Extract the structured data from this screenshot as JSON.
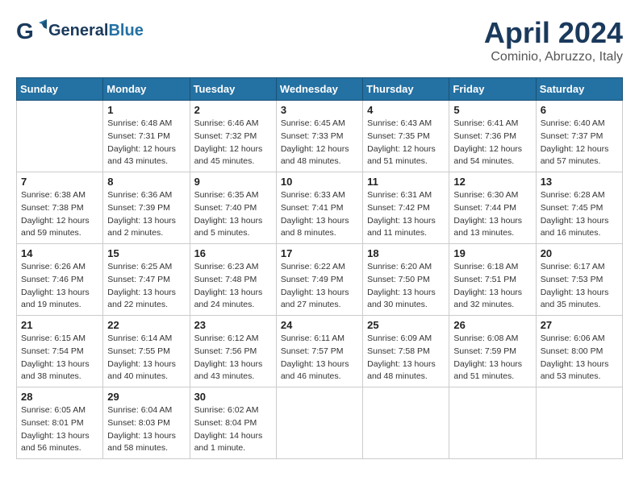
{
  "header": {
    "logo_general": "General",
    "logo_blue": "Blue",
    "month": "April 2024",
    "location": "Cominio, Abruzzo, Italy"
  },
  "weekdays": [
    "Sunday",
    "Monday",
    "Tuesday",
    "Wednesday",
    "Thursday",
    "Friday",
    "Saturday"
  ],
  "weeks": [
    [
      {
        "day": "",
        "sunrise": "",
        "sunset": "",
        "daylight": ""
      },
      {
        "day": "1",
        "sunrise": "Sunrise: 6:48 AM",
        "sunset": "Sunset: 7:31 PM",
        "daylight": "Daylight: 12 hours and 43 minutes."
      },
      {
        "day": "2",
        "sunrise": "Sunrise: 6:46 AM",
        "sunset": "Sunset: 7:32 PM",
        "daylight": "Daylight: 12 hours and 45 minutes."
      },
      {
        "day": "3",
        "sunrise": "Sunrise: 6:45 AM",
        "sunset": "Sunset: 7:33 PM",
        "daylight": "Daylight: 12 hours and 48 minutes."
      },
      {
        "day": "4",
        "sunrise": "Sunrise: 6:43 AM",
        "sunset": "Sunset: 7:35 PM",
        "daylight": "Daylight: 12 hours and 51 minutes."
      },
      {
        "day": "5",
        "sunrise": "Sunrise: 6:41 AM",
        "sunset": "Sunset: 7:36 PM",
        "daylight": "Daylight: 12 hours and 54 minutes."
      },
      {
        "day": "6",
        "sunrise": "Sunrise: 6:40 AM",
        "sunset": "Sunset: 7:37 PM",
        "daylight": "Daylight: 12 hours and 57 minutes."
      }
    ],
    [
      {
        "day": "7",
        "sunrise": "Sunrise: 6:38 AM",
        "sunset": "Sunset: 7:38 PM",
        "daylight": "Daylight: 12 hours and 59 minutes."
      },
      {
        "day": "8",
        "sunrise": "Sunrise: 6:36 AM",
        "sunset": "Sunset: 7:39 PM",
        "daylight": "Daylight: 13 hours and 2 minutes."
      },
      {
        "day": "9",
        "sunrise": "Sunrise: 6:35 AM",
        "sunset": "Sunset: 7:40 PM",
        "daylight": "Daylight: 13 hours and 5 minutes."
      },
      {
        "day": "10",
        "sunrise": "Sunrise: 6:33 AM",
        "sunset": "Sunset: 7:41 PM",
        "daylight": "Daylight: 13 hours and 8 minutes."
      },
      {
        "day": "11",
        "sunrise": "Sunrise: 6:31 AM",
        "sunset": "Sunset: 7:42 PM",
        "daylight": "Daylight: 13 hours and 11 minutes."
      },
      {
        "day": "12",
        "sunrise": "Sunrise: 6:30 AM",
        "sunset": "Sunset: 7:44 PM",
        "daylight": "Daylight: 13 hours and 13 minutes."
      },
      {
        "day": "13",
        "sunrise": "Sunrise: 6:28 AM",
        "sunset": "Sunset: 7:45 PM",
        "daylight": "Daylight: 13 hours and 16 minutes."
      }
    ],
    [
      {
        "day": "14",
        "sunrise": "Sunrise: 6:26 AM",
        "sunset": "Sunset: 7:46 PM",
        "daylight": "Daylight: 13 hours and 19 minutes."
      },
      {
        "day": "15",
        "sunrise": "Sunrise: 6:25 AM",
        "sunset": "Sunset: 7:47 PM",
        "daylight": "Daylight: 13 hours and 22 minutes."
      },
      {
        "day": "16",
        "sunrise": "Sunrise: 6:23 AM",
        "sunset": "Sunset: 7:48 PM",
        "daylight": "Daylight: 13 hours and 24 minutes."
      },
      {
        "day": "17",
        "sunrise": "Sunrise: 6:22 AM",
        "sunset": "Sunset: 7:49 PM",
        "daylight": "Daylight: 13 hours and 27 minutes."
      },
      {
        "day": "18",
        "sunrise": "Sunrise: 6:20 AM",
        "sunset": "Sunset: 7:50 PM",
        "daylight": "Daylight: 13 hours and 30 minutes."
      },
      {
        "day": "19",
        "sunrise": "Sunrise: 6:18 AM",
        "sunset": "Sunset: 7:51 PM",
        "daylight": "Daylight: 13 hours and 32 minutes."
      },
      {
        "day": "20",
        "sunrise": "Sunrise: 6:17 AM",
        "sunset": "Sunset: 7:53 PM",
        "daylight": "Daylight: 13 hours and 35 minutes."
      }
    ],
    [
      {
        "day": "21",
        "sunrise": "Sunrise: 6:15 AM",
        "sunset": "Sunset: 7:54 PM",
        "daylight": "Daylight: 13 hours and 38 minutes."
      },
      {
        "day": "22",
        "sunrise": "Sunrise: 6:14 AM",
        "sunset": "Sunset: 7:55 PM",
        "daylight": "Daylight: 13 hours and 40 minutes."
      },
      {
        "day": "23",
        "sunrise": "Sunrise: 6:12 AM",
        "sunset": "Sunset: 7:56 PM",
        "daylight": "Daylight: 13 hours and 43 minutes."
      },
      {
        "day": "24",
        "sunrise": "Sunrise: 6:11 AM",
        "sunset": "Sunset: 7:57 PM",
        "daylight": "Daylight: 13 hours and 46 minutes."
      },
      {
        "day": "25",
        "sunrise": "Sunrise: 6:09 AM",
        "sunset": "Sunset: 7:58 PM",
        "daylight": "Daylight: 13 hours and 48 minutes."
      },
      {
        "day": "26",
        "sunrise": "Sunrise: 6:08 AM",
        "sunset": "Sunset: 7:59 PM",
        "daylight": "Daylight: 13 hours and 51 minutes."
      },
      {
        "day": "27",
        "sunrise": "Sunrise: 6:06 AM",
        "sunset": "Sunset: 8:00 PM",
        "daylight": "Daylight: 13 hours and 53 minutes."
      }
    ],
    [
      {
        "day": "28",
        "sunrise": "Sunrise: 6:05 AM",
        "sunset": "Sunset: 8:01 PM",
        "daylight": "Daylight: 13 hours and 56 minutes."
      },
      {
        "day": "29",
        "sunrise": "Sunrise: 6:04 AM",
        "sunset": "Sunset: 8:03 PM",
        "daylight": "Daylight: 13 hours and 58 minutes."
      },
      {
        "day": "30",
        "sunrise": "Sunrise: 6:02 AM",
        "sunset": "Sunset: 8:04 PM",
        "daylight": "Daylight: 14 hours and 1 minute."
      },
      {
        "day": "",
        "sunrise": "",
        "sunset": "",
        "daylight": ""
      },
      {
        "day": "",
        "sunrise": "",
        "sunset": "",
        "daylight": ""
      },
      {
        "day": "",
        "sunrise": "",
        "sunset": "",
        "daylight": ""
      },
      {
        "day": "",
        "sunrise": "",
        "sunset": "",
        "daylight": ""
      }
    ]
  ]
}
